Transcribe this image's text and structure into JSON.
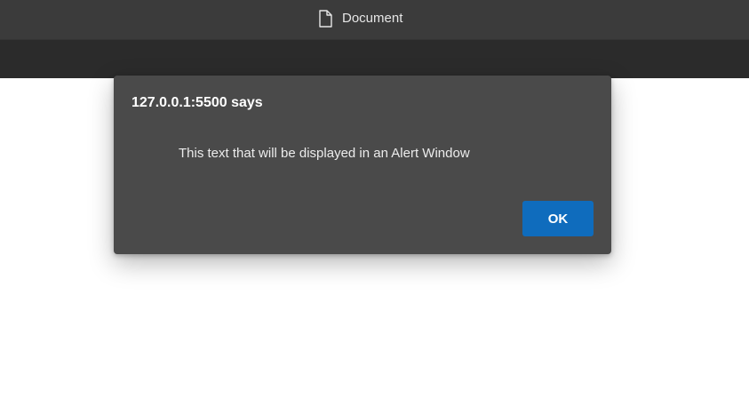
{
  "window": {
    "tab_title": "Document",
    "tab_icon": "document-icon"
  },
  "alert": {
    "title": "127.0.0.1:5500 says",
    "message": "This text that will be displayed in an Alert Window",
    "ok_label": "OK",
    "ok_color": "#0f6cbd",
    "background_color": "#4a4a4a"
  }
}
